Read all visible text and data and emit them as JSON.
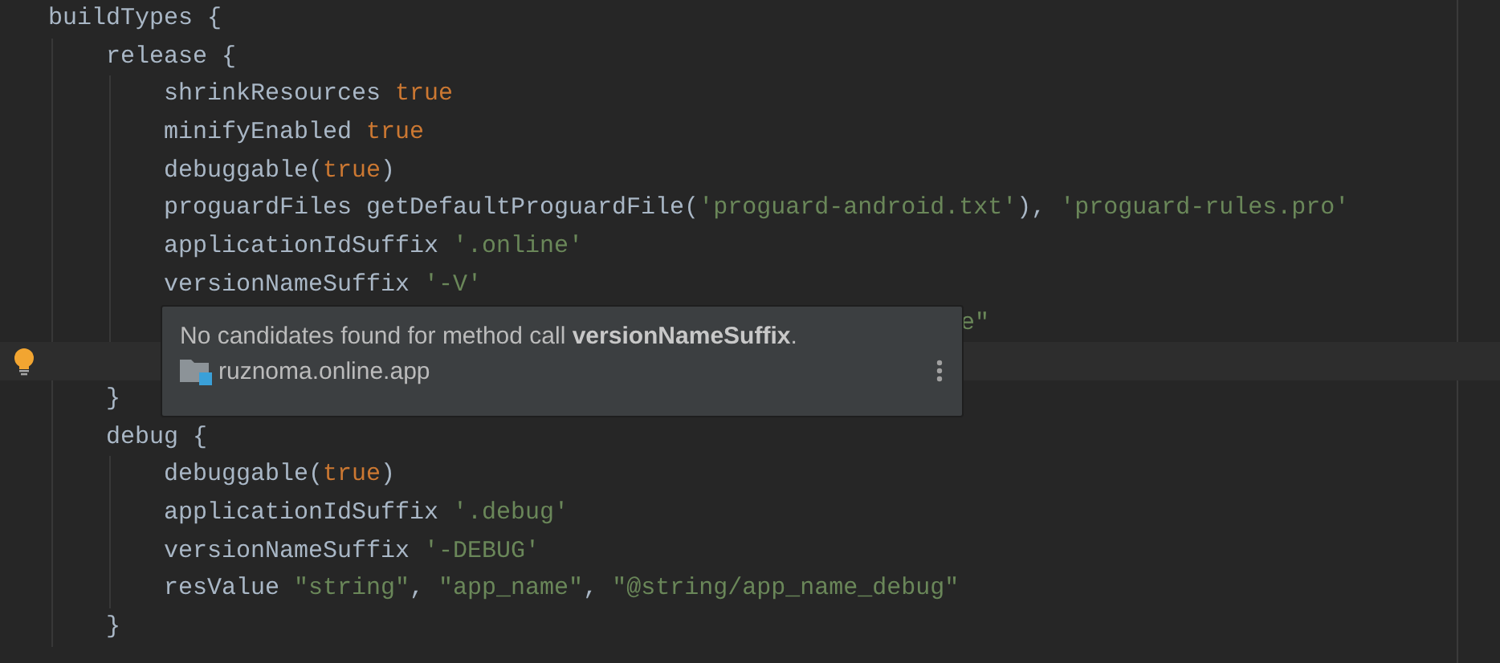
{
  "editor": {
    "lines": [
      {
        "kind": "code",
        "tokens": [
          {
            "text": "buildTypes {",
            "kind": "plain"
          }
        ],
        "children": [
          {
            "kind": "code",
            "tokens": [
              {
                "text": "release {",
                "kind": "plain"
              }
            ],
            "children": [
              {
                "kind": "code",
                "tokens": [
                  {
                    "text": "shrinkResources ",
                    "kind": "plain"
                  },
                  {
                    "text": "true",
                    "kind": "keyword"
                  }
                ]
              },
              {
                "kind": "code",
                "tokens": [
                  {
                    "text": "minifyEnabled ",
                    "kind": "plain"
                  },
                  {
                    "text": "true",
                    "kind": "keyword"
                  }
                ]
              },
              {
                "kind": "code",
                "tokens": [
                  {
                    "text": "debuggable(",
                    "kind": "plain"
                  },
                  {
                    "text": "true",
                    "kind": "keyword"
                  },
                  {
                    "text": ")",
                    "kind": "plain"
                  }
                ]
              },
              {
                "kind": "code",
                "tokens": [
                  {
                    "text": "proguardFiles getDefaultProguardFile(",
                    "kind": "plain"
                  },
                  {
                    "text": "'proguard-android.txt'",
                    "kind": "string"
                  },
                  {
                    "text": "), ",
                    "kind": "plain"
                  },
                  {
                    "text": "'proguard-rules.pro'",
                    "kind": "string"
                  }
                ]
              },
              {
                "kind": "code",
                "tokens": [
                  {
                    "text": "applicationIdSuffix ",
                    "kind": "plain"
                  },
                  {
                    "text": "'.online'",
                    "kind": "string"
                  }
                ]
              },
              {
                "kind": "code",
                "tokens": [
                  {
                    "text": "versionNameSuffix ",
                    "kind": "plain"
                  },
                  {
                    "text": "'-V'",
                    "kind": "string"
                  }
                ]
              },
              {
                "kind": "overlapped",
                "tokens": [
                  {
                    "text": "e\"",
                    "kind": "string"
                  }
                ]
              },
              {
                "kind": "caret_line"
              }
            ]
          },
          {
            "kind": "code",
            "tokens": [
              {
                "text": "}",
                "kind": "plain"
              }
            ]
          },
          {
            "kind": "code",
            "tokens": [
              {
                "text": "debug {",
                "kind": "plain"
              }
            ],
            "children": [
              {
                "kind": "code",
                "tokens": [
                  {
                    "text": "debuggable(",
                    "kind": "plain"
                  },
                  {
                    "text": "true",
                    "kind": "keyword"
                  },
                  {
                    "text": ")",
                    "kind": "plain"
                  }
                ]
              },
              {
                "kind": "code",
                "tokens": [
                  {
                    "text": "applicationIdSuffix ",
                    "kind": "plain"
                  },
                  {
                    "text": "'.debug'",
                    "kind": "string"
                  }
                ]
              },
              {
                "kind": "code",
                "tokens": [
                  {
                    "text": "versionNameSuffix ",
                    "kind": "plain"
                  },
                  {
                    "text": "'-DEBUG'",
                    "kind": "string"
                  }
                ]
              },
              {
                "kind": "code",
                "tokens": [
                  {
                    "text": "resValue ",
                    "kind": "plain"
                  },
                  {
                    "text": "\"string\"",
                    "kind": "string"
                  },
                  {
                    "text": ", ",
                    "kind": "plain"
                  },
                  {
                    "text": "\"app_name\"",
                    "kind": "string"
                  },
                  {
                    "text": ", ",
                    "kind": "plain"
                  },
                  {
                    "text": "\"@string/app_name_debug\"",
                    "kind": "string"
                  }
                ]
              }
            ]
          },
          {
            "kind": "code",
            "tokens": [
              {
                "text": "}",
                "kind": "plain"
              }
            ]
          }
        ]
      }
    ]
  },
  "hint_popup": {
    "message": "No candidates found for method call **versionNameSuffix**.",
    "module": "ruznoma.online.app"
  }
}
